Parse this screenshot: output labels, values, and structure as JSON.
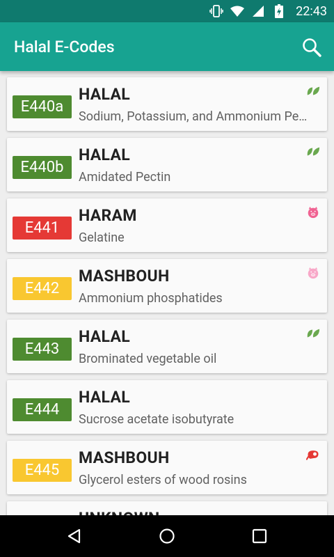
{
  "status_bar": {
    "time": "22:43"
  },
  "app_bar": {
    "title": "Halal E-Codes"
  },
  "colors": {
    "halal": "#4e8b30",
    "haram": "#e53935",
    "mashbouh": "#f9c730",
    "unknown": "#555555",
    "icon_leaf": "#6aa84f",
    "icon_pig": "#f06292",
    "icon_pig_light": "#f8a8c8",
    "icon_meat": "#e53935"
  },
  "items": [
    {
      "code": "E440a",
      "status": "HALAL",
      "description": "Sodium, Potassium, and Ammonium Pectates",
      "icon": "leaf-icon",
      "color": "#4e8b30"
    },
    {
      "code": "E440b",
      "status": "HALAL",
      "description": "Amidated Pectin",
      "icon": "leaf-icon",
      "color": "#4e8b30"
    },
    {
      "code": "E441",
      "status": "HARAM",
      "description": "Gelatine",
      "icon": "pig-icon",
      "color": "#e53935"
    },
    {
      "code": "E442",
      "status": "MASHBOUH",
      "description": "Ammonium phosphatides",
      "icon": "pig-icon",
      "color": "#f9c730"
    },
    {
      "code": "E443",
      "status": "HALAL",
      "description": "Brominated vegetable oil",
      "icon": "leaf-icon",
      "color": "#4e8b30"
    },
    {
      "code": "E444",
      "status": "HALAL",
      "description": "Sucrose acetate isobutyrate",
      "icon": "",
      "color": "#4e8b30"
    },
    {
      "code": "E445",
      "status": "MASHBOUH",
      "description": "Glycerol esters of wood rosins",
      "icon": "meat-icon",
      "color": "#f9c730"
    },
    {
      "code": "",
      "status": "UNKNOWN",
      "description": "",
      "icon": "",
      "color": "#555555"
    }
  ]
}
